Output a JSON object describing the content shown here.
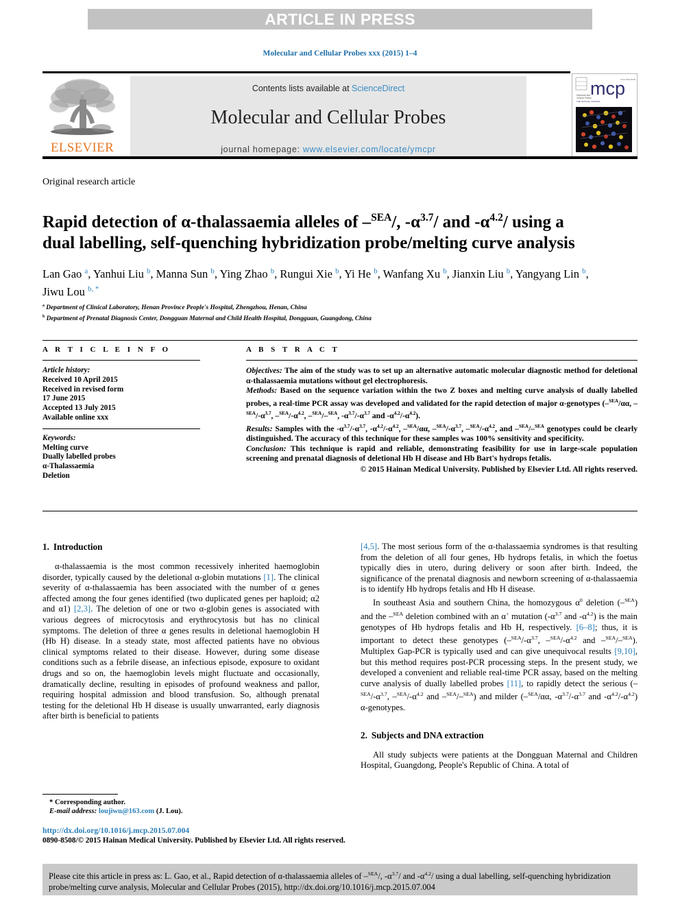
{
  "banner": {
    "text": "ARTICLE IN PRESS"
  },
  "running_head": {
    "text": "Molecular and Cellular Probes xxx (2015) 1–4"
  },
  "masthead": {
    "contents_prefix": "Contents lists available at ",
    "sciencedirect": "ScienceDirect",
    "journal_title": "Molecular and Cellular Probes",
    "homepage_label": "journal homepage: ",
    "homepage_url": "www.elsevier.com/locate/ymcpr",
    "publisher": "ELSEVIER",
    "cover_alt": "mcp",
    "cover_title": "mcp",
    "cover_subtitle": "Molecular and Cellular Probes"
  },
  "article_type": "Original research article",
  "title_parts": [
    "Rapid detection of α-thalassaemia alleles of –",
    "SEA",
    "/, -α",
    "3.7",
    "/ and -α",
    "4.2",
    "/ using a dual labelling, self-quenching hybridization probe/melting curve analysis"
  ],
  "authors": [
    {
      "name": "Lan Gao",
      "mark": "a"
    },
    {
      "name": "Yanhui Liu",
      "mark": "b"
    },
    {
      "name": "Manna Sun",
      "mark": "b"
    },
    {
      "name": "Ying Zhao",
      "mark": "b"
    },
    {
      "name": "Rungui Xie",
      "mark": "b"
    },
    {
      "name": "Yi He",
      "mark": "b"
    },
    {
      "name": "Wanfang Xu",
      "mark": "b"
    },
    {
      "name": "Jianxin Liu",
      "mark": "b"
    },
    {
      "name": "Yangyang Lin",
      "mark": "b"
    },
    {
      "name": "Jiwu Lou",
      "mark": "b, *"
    }
  ],
  "affiliations": [
    {
      "mark": "a",
      "text": "Department of Clinical Laboratory, Henan Province People's Hospital, Zhengzhou, Henan, China"
    },
    {
      "mark": "b",
      "text": "Department of Prenatal Diagnosis Center, Dongguan Maternal and Child Health Hospital, Dongguan, Guangdong, China"
    }
  ],
  "article_info": {
    "heading": "A R T I C L E   I N F O",
    "history_label": "Article history:",
    "history": [
      "Received 10 April 2015",
      "Received in revised form",
      "17 June 2015",
      "Accepted 13 July 2015",
      "Available online xxx"
    ],
    "keywords_label": "Keywords:",
    "keywords": [
      "Melting curve",
      "Dually labelled probes",
      "α-Thalassaemia",
      "Deletion"
    ]
  },
  "abstract": {
    "heading": "A B S T R A C T",
    "objectives_label": "Objectives:",
    "objectives_text": " The aim of the study was to set up an alternative automatic molecular diagnostic method for deletional α-thalassaemia mutations without gel electrophoresis.",
    "methods_label": "Methods:",
    "methods_text": " Based on the sequence variation within the two Z boxes and melting curve analysis of dually labelled probes, a real-time PCR assay was developed and validated for the rapid detection of major α-genotypes (–SEA/αα, –SEA/-α3.7, –SEA/-α4.2, –SEA/–SEA, -α3.7/-α3.7 and -α4.2/-α4.2).",
    "results_label": "Results:",
    "results_text": " Samples with the -α3.7/-α3.7, -α4.2/-α4.2, –SEA/αα, –SEA/-α3.7, –SEA/-α4.2, and –SEA/–SEA genotypes could be clearly distinguished. The accuracy of this technique for these samples was 100% sensitivity and specificity.",
    "conclusion_label": "Conclusion:",
    "conclusion_text": " This technique is rapid and reliable, demonstrating feasibility for use in large-scale population screening and prenatal diagnosis of deletional Hb H disease and Hb Bart's hydrops fetalis.",
    "copyright": "© 2015 Hainan Medical University. Published by Elsevier Ltd. All rights reserved."
  },
  "sections": {
    "intro": {
      "number": "1.",
      "title": "Introduction",
      "p1": "α-thalassaemia is the most common recessively inherited haemoglobin disorder, typically caused by the deletional α-globin mutations [1]. The clinical severity of α-thalassaemia has been associated with the number of α genes affected among the four genes identified (two duplicated genes per haploid; α2 and α1) [2,3]. The deletion of one or two α-globin genes is associated with various degrees of microcytosis and erythrocytosis but has no clinical symptoms. The deletion of three α genes results in deletional haemoglobin H (Hb H) disease. In a steady state, most affected patients have no obvious clinical symptoms related to their disease. However, during some disease conditions such as a febrile disease, an infectious episode, exposure to oxidant drugs and so on, the haemoglobin levels might fluctuate and occasionally, dramatically decline, resulting in episodes of profound weakness and pallor, requiring hospital admission and blood transfusion. So, although prenatal testing for the deletional Hb H disease is usually unwarranted, early diagnosis after birth is beneficial to patients",
      "p2": "[4,5]. The most serious form of the α-thalassaemia syndromes is that resulting from the deletion of all four genes, Hb hydrops fetalis, in which the foetus typically dies in utero, during delivery or soon after birth. Indeed, the significance of the prenatal diagnosis and newborn screening of α-thalassaemia is to identify Hb hydrops fetalis and Hb H disease.",
      "p3": "In southeast Asia and southern China, the homozygous α0 deletion (–SEA) and the –SEA deletion combined with an α+ mutation (-α3.7 and -α4.2) is the main genotypes of Hb hydrops fetalis and Hb H, respectively. [6–8]; thus, it is important to detect these genotypes (–SEA/-α3.7, –SEA/-α4.2 and –SEA/–SEA). Multiplex Gap-PCR is typically used and can give unequivocal results [9,10], but this method requires post-PCR processing steps. In the present study, we developed a convenient and reliable real-time PCR assay, based on the melting curve analysis of dually labelled probes [11], to rapidly detect the serious (–SEA/-α3.7, –SEA/-α4.2 and –SEA/–SEA) and milder (–SEA/αα, -α3.7/-α3.7 and -α4.2/-α4.2) α-genotypes."
    },
    "subjects": {
      "number": "2.",
      "title": "Subjects and DNA extraction",
      "p1": "All study subjects were patients at the Dongguan Maternal and Children Hospital, Guangdong, People's Republic of China. A total of"
    }
  },
  "footnote": {
    "corresponding": "* Corresponding author.",
    "email_label": "E-mail address:",
    "email": "loujiwu@163.com",
    "email_suffix": " (J. Lou)."
  },
  "doi": {
    "url": "http://dx.doi.org/10.1016/j.mcp.2015.07.004",
    "issn_line": "0890-8508/© 2015 Hainan Medical University. Published by Elsevier Ltd. All rights reserved."
  },
  "citation_box": {
    "line1_a": "Please cite this article in press as: L. Gao, et al., Rapid detection of α-thalassaemia alleles of –",
    "line1_sup1": "SEA",
    "line1_b": "/, -α",
    "line1_sup2": "3.7",
    "line1_c": "/ and -α",
    "line1_sup3": "4.2",
    "line1_d": "/ using a dual labelling, self-quenching hybridization probe/melting curve analysis, Molecular and Cellular Probes (2015), http://dx.doi.org/10.1016/j.mcp.2015.07.004"
  },
  "colors": {
    "link": "#2a7fb8",
    "banner_bg": "#c2c2c2",
    "band_bg": "#e6e6e6",
    "elsevier_orange": "#E87722",
    "cite_bg": "#c9c9c9"
  }
}
